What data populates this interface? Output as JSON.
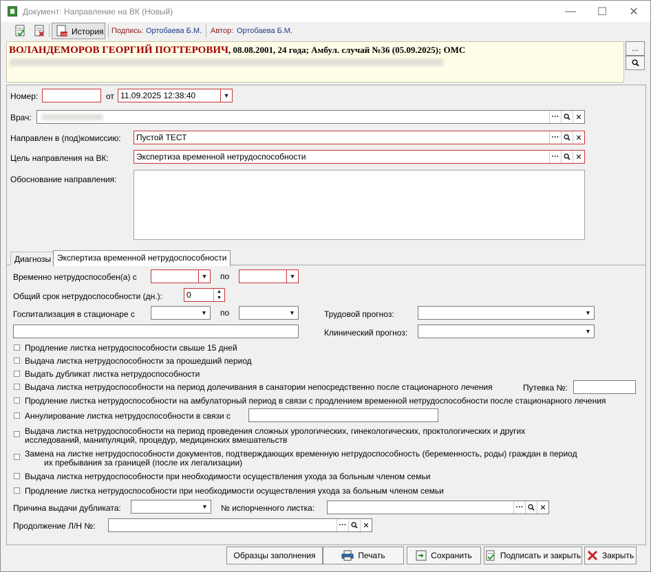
{
  "window": {
    "title": "Документ: Направление на ВК (Новый)",
    "minimize": "—",
    "maximize": "☐",
    "close": "✕"
  },
  "toolbar": {
    "history_label": "История",
    "signature_label": "Подпись:",
    "signature_value": "Ортобаева Б.М.",
    "author_label": "Автор:",
    "author_value": "Ортобаева Б.М."
  },
  "patient": {
    "name": "ВОЛАНДЕМОРОВ ГЕОРГИЙ ПОТТЕРОВИЧ",
    "info": ", 08.08.2001, 24 года; Амбул. случай №36 (05.09.2025); ОМС",
    "more_button": "...",
    "search_button": "🔍"
  },
  "form": {
    "number_label": "Номер:",
    "number_value": "",
    "from_label": "от",
    "date_value": "11.09.2025 12:38:40",
    "doctor_label": "Врач:",
    "commission_label": "Направлен в (под)комиссию:",
    "commission_value": "Пустой ТЕСТ",
    "purpose_label": "Цель направления на ВК:",
    "purpose_value": "Экспертиза временной нетрудоспособности",
    "justification_label": "Обоснование направления:",
    "justification_value": ""
  },
  "tabs": [
    {
      "label": "Диагнозы",
      "active": false
    },
    {
      "label": "Экспертиза временной нетрудоспособности",
      "active": true
    }
  ],
  "expertise": {
    "disabled_from_label": "Временно нетрудоспособен(а) с",
    "to_label": "по",
    "total_days_label": "Общий срок нетрудоспособности (дн.):",
    "total_days_value": "0",
    "hospital_label": "Госпитализация в стационаре с",
    "hospital_to_label": "по",
    "work_prognosis_label": "Трудовой прогноз:",
    "clinical_prognosis_label": "Клинический прогноз:",
    "checkboxes": [
      "Продление листка нетрудоспособности свыше 15 дней",
      "Выдача листка нетрудоспособности за прошедший период",
      "Выдать дубликат листка нетрудоспособности",
      "Выдача листка нетрудоспособности на период долечивания в санатории непосредственно после стационарного лечения",
      "Продление листка нетрудоспособности на амбулаторный период в связи с продлением временной нетрудоспособности после стационарного лечения",
      "Аннулирование листка нетрудоспособности в связи с",
      "Выдача листка нетрудоспособности на период проведения сложных урологических, гинекологических, проктологических и других",
      "Замена на листке нетрудоспособности документов, подтверждающих временную нетрудоспособность (беременность, роды) граждан в период",
      "Выдача листка нетрудоспособности при необходимости осуществления ухода за больным членом семьи",
      "Продление листка нетрудоспособности при необходимости осуществления ухода за больным членом семьи"
    ],
    "checkbox_line2": [
      "исследований, манипуляций, процедур, медицинских вмешательств",
      "их пребывания за границей (после их легализации)"
    ],
    "voucher_label": "Путевка №:",
    "duplicate_reason_label": "Причина выдачи дубликата:",
    "spoiled_sheet_label": "№ испорченного листка:",
    "continuation_label": "Продолжение Л/Н №:"
  },
  "buttons": {
    "samples": "Образцы заполнения",
    "print": "Печать",
    "save": "Сохранить",
    "sign_close": "Подписать и закрыть",
    "close": "Закрыть"
  },
  "colors": {
    "required_border": "#c83535",
    "patient_bg": "#fffde8",
    "patient_name": "#a00000"
  }
}
